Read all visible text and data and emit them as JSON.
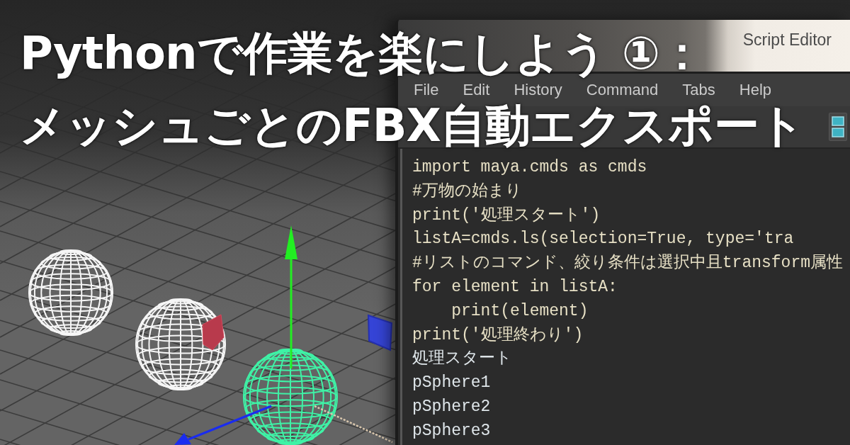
{
  "headline": {
    "lines": [
      "Pythonで作業を楽にしよう ①：",
      "メッシュごとのFBX自動エクスポート"
    ]
  },
  "viewport": {
    "spheres": [
      {
        "selected": false
      },
      {
        "selected": false
      },
      {
        "selected": true
      }
    ]
  },
  "script_editor": {
    "title": "Script Editor",
    "menu": [
      "File",
      "Edit",
      "History",
      "Command",
      "Tabs",
      "Help"
    ],
    "code_lines": [
      {
        "kind": "input",
        "text": "import maya.cmds as cmds"
      },
      {
        "kind": "input",
        "text": "#万物の始まり"
      },
      {
        "kind": "input",
        "text": "print('処理スタート')"
      },
      {
        "kind": "input",
        "text": "listA=cmds.ls(selection=True, type='tra"
      },
      {
        "kind": "input",
        "text": "#リストのコマンド、絞り条件は選択中且transform属性"
      },
      {
        "kind": "input",
        "text": "for element in listA:"
      },
      {
        "kind": "input",
        "text": "    print(element)"
      },
      {
        "kind": "input",
        "text": "print('処理終わり')"
      },
      {
        "kind": "output",
        "text": "処理スタート"
      },
      {
        "kind": "output",
        "text": "pSphere1"
      },
      {
        "kind": "output",
        "text": "pSphere2"
      },
      {
        "kind": "output",
        "text": "pSphere3"
      }
    ]
  }
}
